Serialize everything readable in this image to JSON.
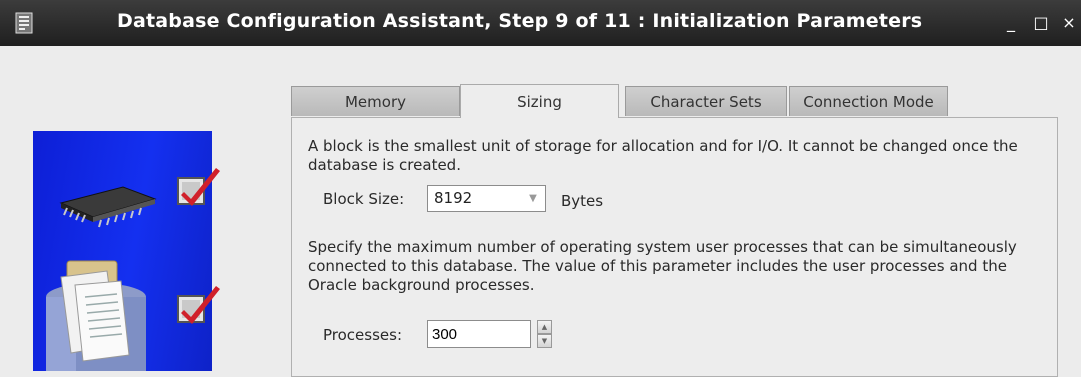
{
  "window": {
    "title": "Database Configuration Assistant, Step 9 of 11 : Initialization Parameters",
    "minimize_glyph": "_",
    "maximize_glyph": "□",
    "close_glyph": "×"
  },
  "tabs": [
    {
      "label": "Memory",
      "active": false
    },
    {
      "label": "Sizing",
      "active": true
    },
    {
      "label": "Character Sets",
      "active": false
    },
    {
      "label": "Connection Mode",
      "active": false
    }
  ],
  "sizing": {
    "block_description": "A block is the smallest unit of storage for allocation and for I/O. It cannot be changed once the database is created.",
    "block_size_label": "Block Size:",
    "block_size_value": "8192",
    "block_size_unit": "Bytes",
    "processes_description": "Specify the maximum number of operating system user processes that can be simultaneously connected to this database. The value of this parameter includes the user processes and the Oracle background processes.",
    "processes_label": "Processes:",
    "processes_value": "300"
  },
  "side_panel": {
    "icons": [
      "memory-chip-icon",
      "checked-checkbox-icon",
      "database-documents-icon",
      "checked-checkbox-icon"
    ]
  },
  "colors": {
    "titlebar": "#2b2b2b",
    "side_panel_blue": "#1430f0",
    "check_red": "#d0202a"
  }
}
